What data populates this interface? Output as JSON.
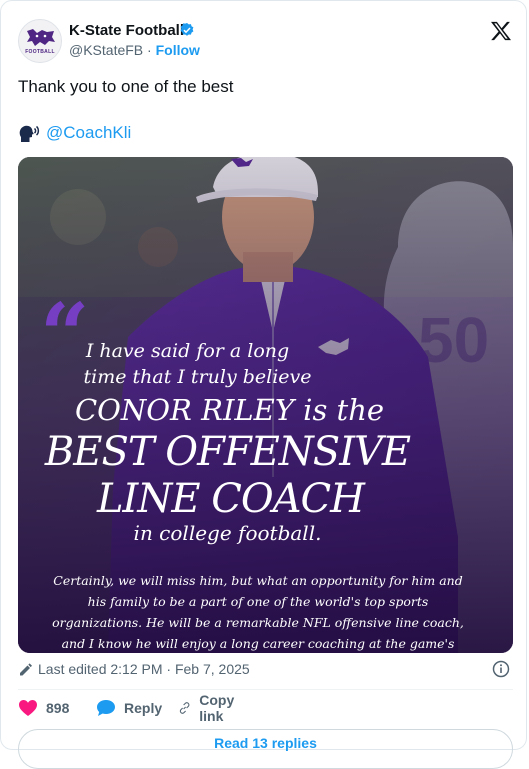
{
  "tweet": {
    "author_name": "K-State Football",
    "handle": "@KStateFB",
    "separator": "·",
    "follow_label": "Follow",
    "avatar_tag": "FOOTBALL",
    "text": "Thank you to one of the best",
    "mention": "@CoachKli",
    "quote": {
      "line1": "I have said for a long",
      "line2": "time that I truly believe",
      "line3": "CONOR RILEY is the",
      "line4": "BEST OFFENSIVE",
      "line5": "LINE COACH",
      "line6": "in college football.",
      "subtext": "Certainly, we will miss him, but what an opportunity for him and his family to be a part of one of the world's top sports organizations. He will be a remarkable NFL offensive line coach, and I know he will enjoy a long career coaching at the game's highest level."
    },
    "jersey_number": "50",
    "edited_label": "Last edited 2:12 PM · Feb 7, 2025",
    "likes": "898",
    "reply_label": "Reply",
    "copy_link_label": "Copy link",
    "read_replies_label": "Read 13 replies"
  },
  "colors": {
    "accent": "#1d9bf0",
    "like": "#f91880",
    "kstate_purple": "#512888",
    "text_secondary": "#536471"
  },
  "icons": [
    "kstate-wildcat-logo",
    "verified-badge-icon",
    "x-logo-icon",
    "speaking-head-icon",
    "pencil-icon",
    "info-icon",
    "heart-icon",
    "reply-bubble-icon",
    "link-icon"
  ]
}
